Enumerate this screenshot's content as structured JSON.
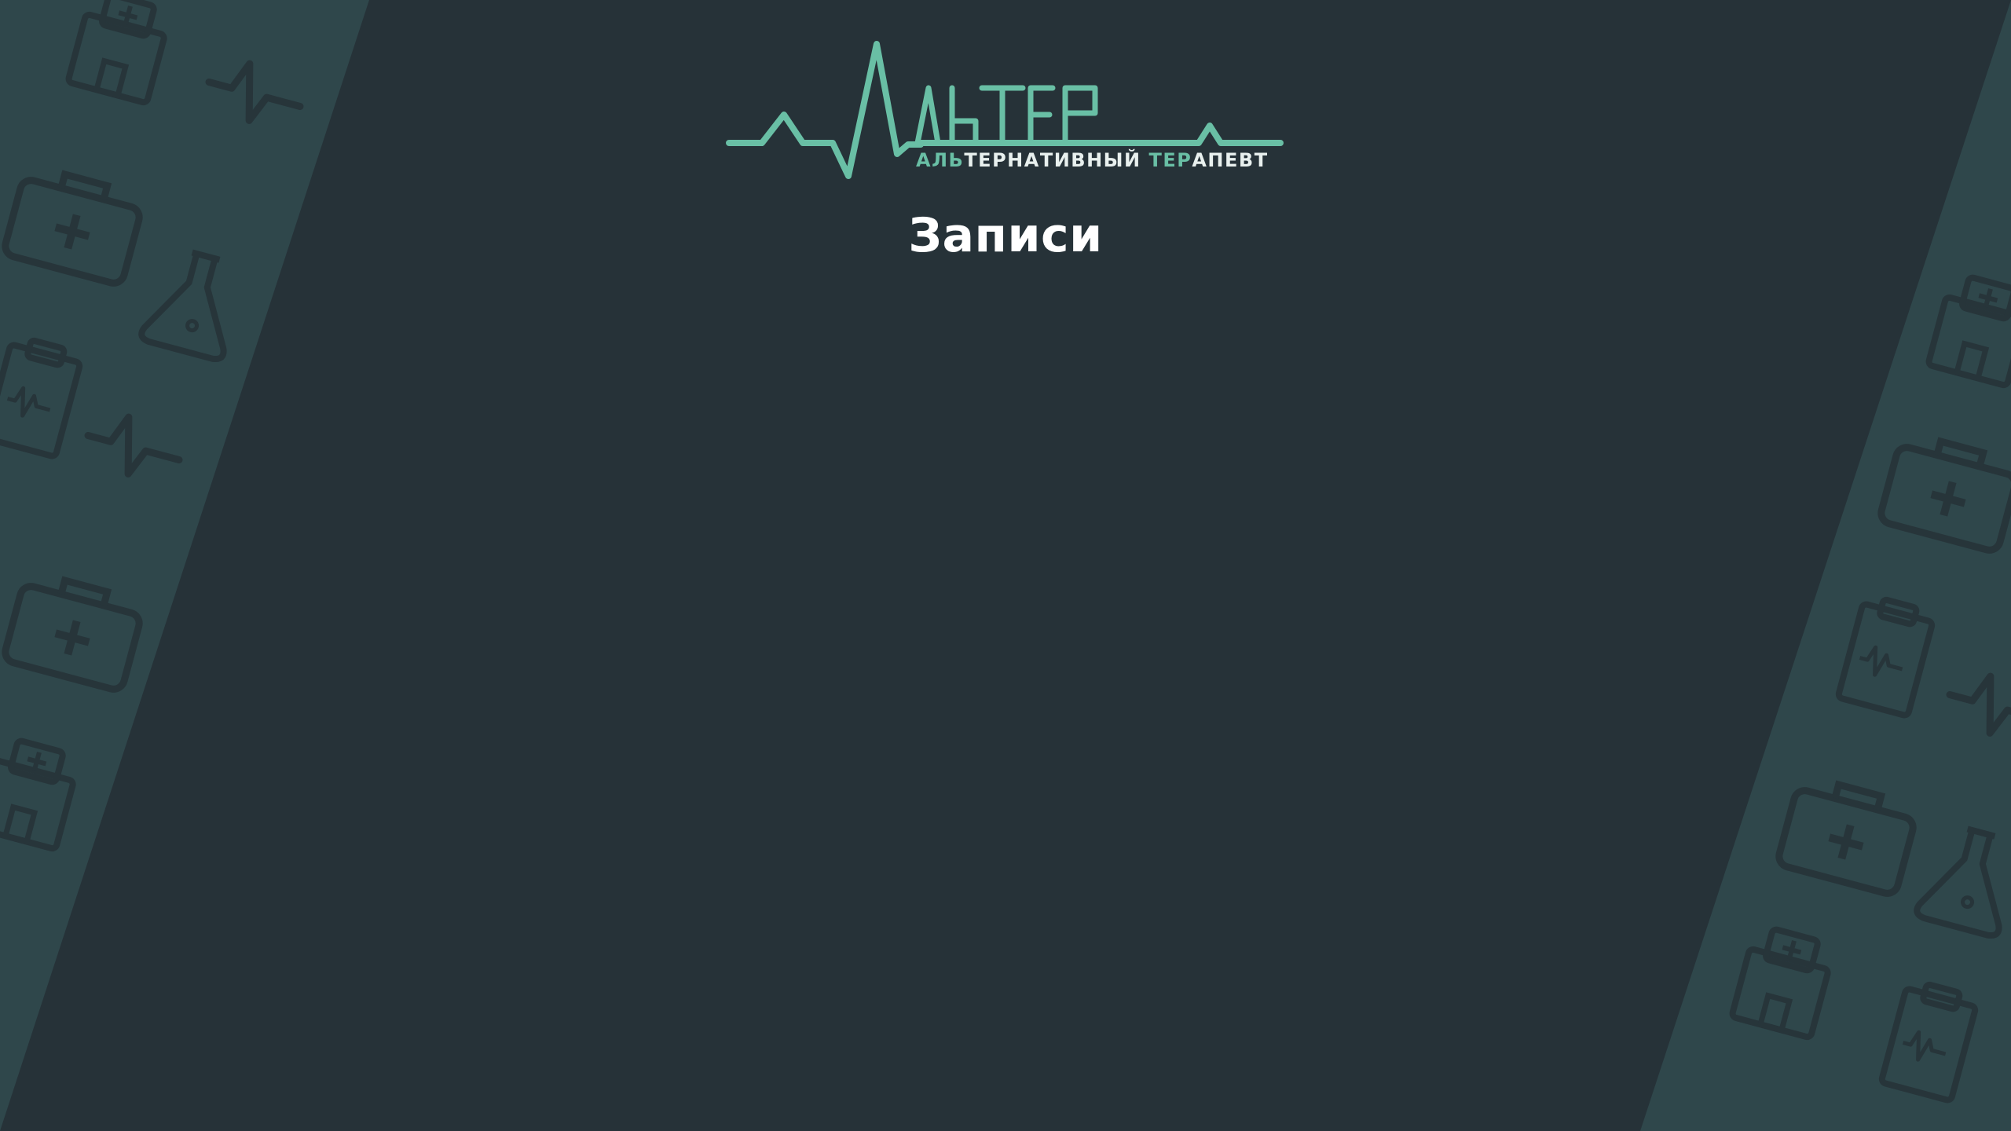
{
  "logo": {
    "wordmark": "АЛЬТЕР",
    "tagline_highlight_1": "АЛЬ",
    "tagline_part_1": "ТЕРНАТИВНЫЙ ",
    "tagline_highlight_2": "ТЕР",
    "tagline_part_2": "АПЕВТ"
  },
  "page": {
    "title": "Записи"
  },
  "colors": {
    "background": "#263238",
    "panel": "#2f474b",
    "pattern_icon": "#263238",
    "accent": "#69bfa5",
    "title": "#ffffff",
    "tagline": "#e8f0ee"
  },
  "icons": {
    "pattern": [
      "first-aid-kit-icon",
      "heartbeat-icon",
      "flask-icon",
      "clipboard-icon",
      "hospital-icon"
    ]
  }
}
